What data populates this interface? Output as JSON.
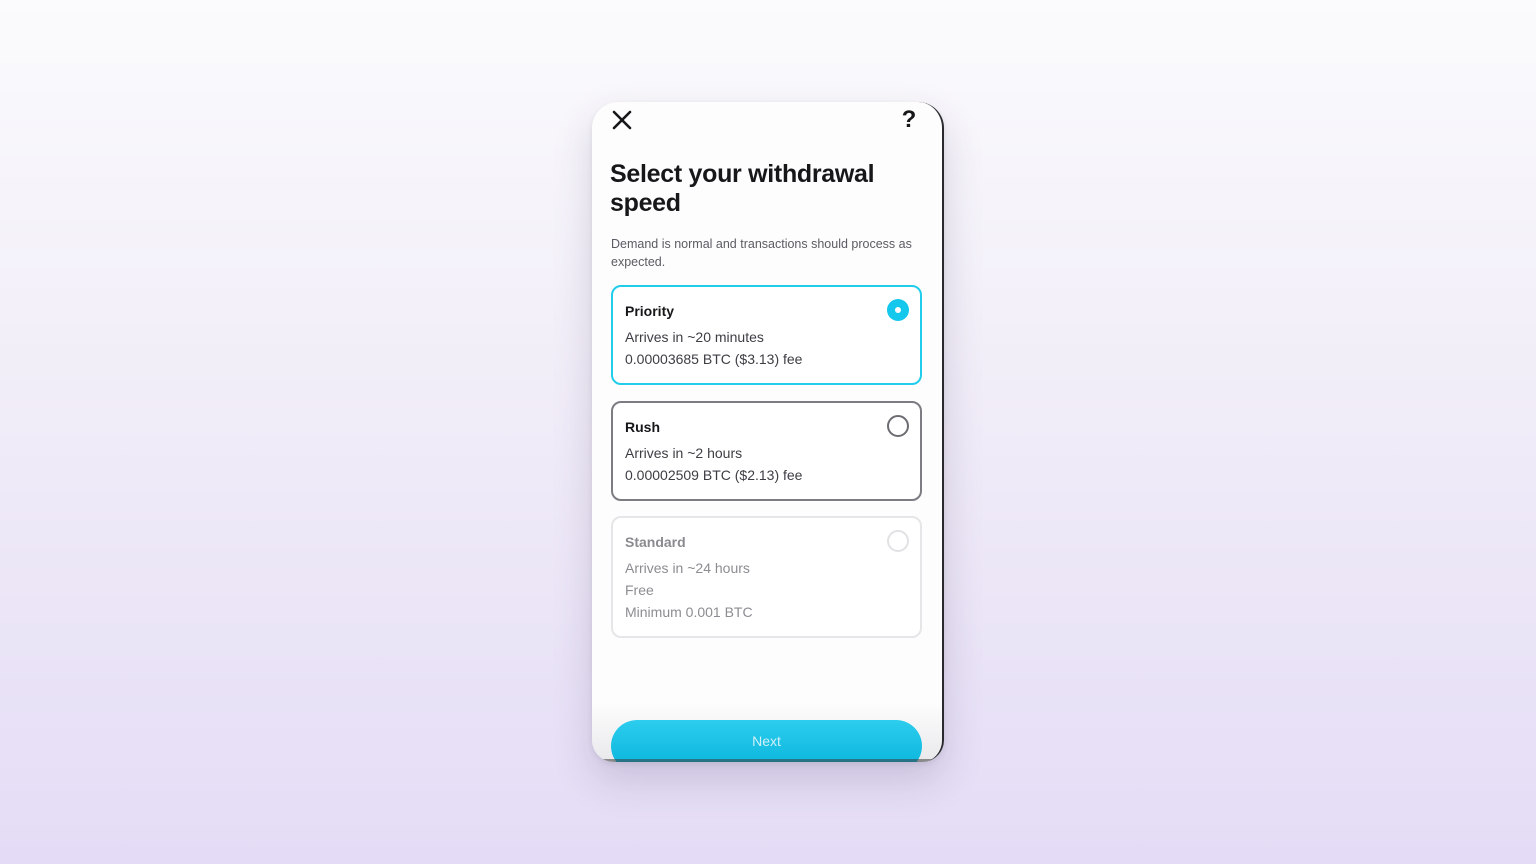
{
  "header": {
    "close_icon": "close-icon",
    "help_label": "?"
  },
  "title": "Select your withdrawal speed",
  "subtitle": "Demand is normal and transactions should process as expected.",
  "options": [
    {
      "name": "Priority",
      "eta": "Arrives in ~20 minutes",
      "fee": "0.00003685 BTC ($3.13) fee",
      "selected": true
    },
    {
      "name": "Rush",
      "eta": "Arrives in ~2 hours",
      "fee": "0.00002509 BTC ($2.13) fee",
      "selected": false
    },
    {
      "name": "Standard",
      "eta": "Arrives in ~24 hours",
      "fee": "Free",
      "minimum": "Minimum 0.001 BTC",
      "selected": false,
      "disabled": true
    }
  ],
  "footer": {
    "next_label": "Next"
  },
  "colors": {
    "accent": "#13c8ec",
    "selected_border": "#21cdea",
    "background_top": "#fbfbfd",
    "background_bottom": "#e4dcf6"
  }
}
